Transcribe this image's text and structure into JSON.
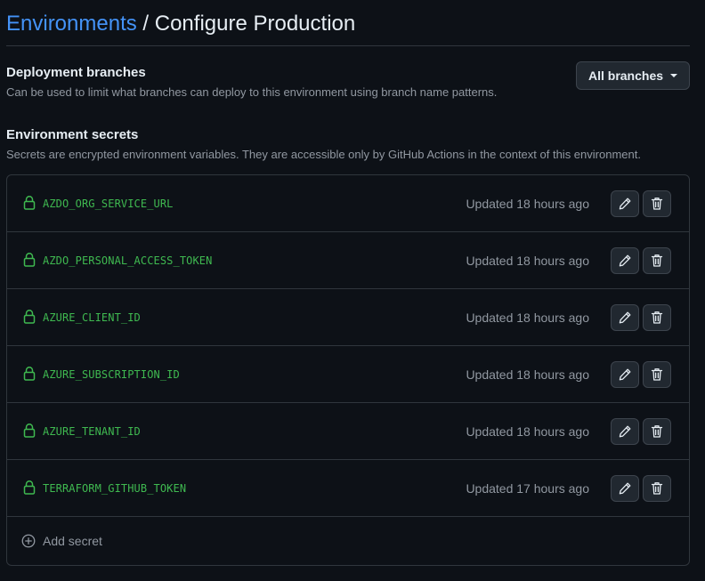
{
  "header": {
    "link": "Environments",
    "separator": "/",
    "current": "Configure Production"
  },
  "branches": {
    "title": "Deployment branches",
    "description": "Can be used to limit what branches can deploy to this environment using branch name patterns.",
    "button_label": "All branches"
  },
  "secrets": {
    "title": "Environment secrets",
    "description": "Secrets are encrypted environment variables. They are accessible only by GitHub Actions in the context of this environment.",
    "items": [
      {
        "name": "AZDO_ORG_SERVICE_URL",
        "updated": "Updated 18 hours ago"
      },
      {
        "name": "AZDO_PERSONAL_ACCESS_TOKEN",
        "updated": "Updated 18 hours ago"
      },
      {
        "name": "AZURE_CLIENT_ID",
        "updated": "Updated 18 hours ago"
      },
      {
        "name": "AZURE_SUBSCRIPTION_ID",
        "updated": "Updated 18 hours ago"
      },
      {
        "name": "AZURE_TENANT_ID",
        "updated": "Updated 18 hours ago"
      },
      {
        "name": "TERRAFORM_GITHUB_TOKEN",
        "updated": "Updated 17 hours ago"
      }
    ],
    "add_label": "Add secret"
  },
  "colors": {
    "background": "#0d1117",
    "link": "#4493f8",
    "secret_name": "#3fb950",
    "muted": "#9198a1",
    "border": "#30363d"
  },
  "icons": {
    "secret": "lock-icon",
    "edit": "pencil-icon",
    "delete": "trash-icon",
    "add": "plus-circle-icon",
    "dropdown": "caret-down-icon"
  }
}
